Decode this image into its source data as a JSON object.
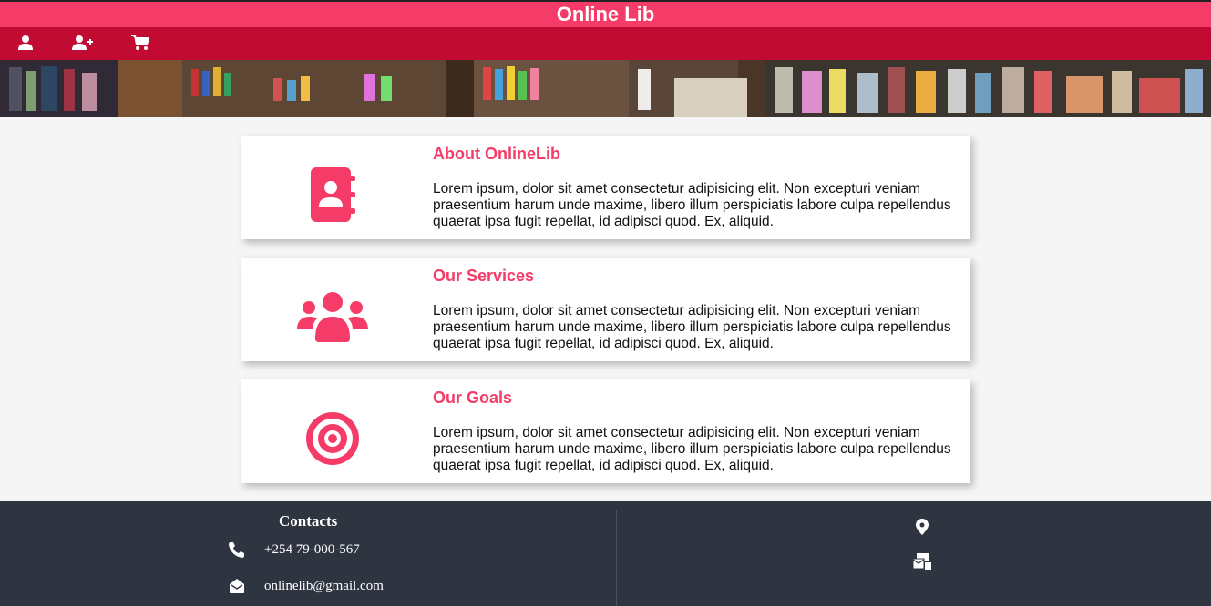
{
  "app": {
    "title": "Online Lib"
  },
  "nav": {
    "icons": [
      "user-icon",
      "add-user-icon",
      "shopping-cart-icon"
    ]
  },
  "colors": {
    "accent": "#f53b68",
    "nav": "#c10b33",
    "footer": "#2e3440"
  },
  "cards": [
    {
      "icon": "contact-book-icon",
      "title": "About OnlineLib",
      "text": "Lorem ipsum, dolor sit amet consectetur adipisicing elit. Non excepturi veniam praesentium harum unde maxime, libero illum perspiciatis labore culpa repellendus quaerat ipsa fugit repellat, id adipisci quod. Ex, aliquid."
    },
    {
      "icon": "users-group-icon",
      "title": "Our Services",
      "text": "Lorem ipsum, dolor sit amet consectetur adipisicing elit. Non excepturi veniam praesentium harum unde maxime, libero illum perspiciatis labore culpa repellendus quaerat ipsa fugit repellat, id adipisci quod. Ex, aliquid."
    },
    {
      "icon": "target-icon",
      "title": "Our Goals",
      "text": "Lorem ipsum, dolor sit amet consectetur adipisicing elit. Non excepturi veniam praesentium harum unde maxime, libero illum perspiciatis labore culpa repellendus quaerat ipsa fugit repellat, id adipisci quod. Ex, aliquid."
    }
  ],
  "footer": {
    "contacts_title": "Contacts",
    "phone": "+254 79-000-567",
    "email": "onlinelib@gmail.com",
    "right_icons": [
      "location-pin-icon",
      "mail-bulk-icon"
    ]
  }
}
